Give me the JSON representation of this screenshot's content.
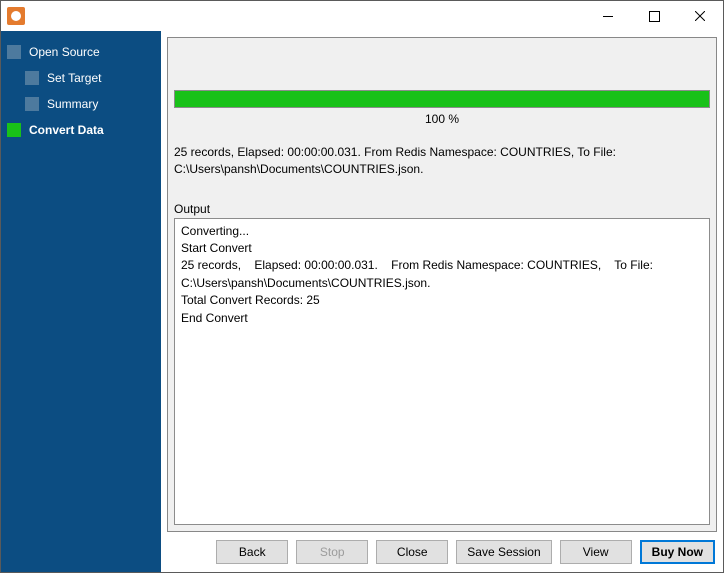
{
  "titlebar": {
    "title": ""
  },
  "sidebar": {
    "items": [
      {
        "label": "Open Source",
        "active": false,
        "child": false
      },
      {
        "label": "Set Target",
        "active": false,
        "child": true
      },
      {
        "label": "Summary",
        "active": false,
        "child": true
      },
      {
        "label": "Convert Data",
        "active": true,
        "child": false
      }
    ]
  },
  "progress": {
    "percent_label": "100 %",
    "fill_percent": "100%"
  },
  "status": {
    "line1": "25 records,    Elapsed: 00:00:00.031.    From Redis Namespace: COUNTRIES,    To File:",
    "line2": "C:\\Users\\pansh\\Documents\\COUNTRIES.json."
  },
  "output": {
    "label": "Output",
    "text": "Converting...\nStart Convert\n25 records,    Elapsed: 00:00:00.031.    From Redis Namespace: COUNTRIES,    To File: C:\\Users\\pansh\\Documents\\COUNTRIES.json.\nTotal Convert Records: 25\nEnd Convert"
  },
  "footer": {
    "back": "Back",
    "stop": "Stop",
    "close": "Close",
    "save_session": "Save Session",
    "view": "View",
    "buy_now": "Buy Now"
  }
}
